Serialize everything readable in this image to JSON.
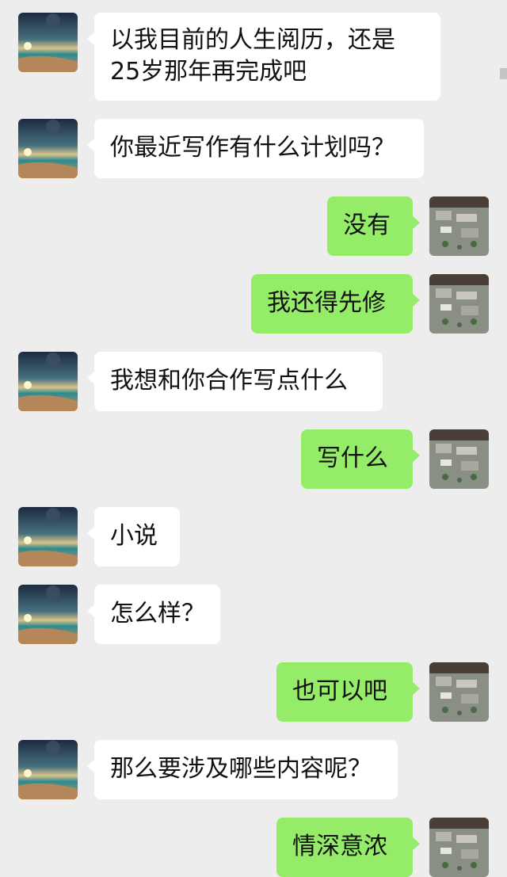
{
  "messages": [
    {
      "side": "in",
      "text": "以我目前的人生阅历，还是\n25岁那年再完成吧"
    },
    {
      "side": "in",
      "text": "你最近写作有什么计划吗？"
    },
    {
      "side": "out",
      "text": "没有"
    },
    {
      "side": "out",
      "text": "我还得先修"
    },
    {
      "side": "in",
      "text": "我想和你合作写点什么"
    },
    {
      "side": "out",
      "text": "写什么"
    },
    {
      "side": "in",
      "text": "小说"
    },
    {
      "side": "in",
      "text": "怎么样？"
    },
    {
      "side": "out",
      "text": "也可以吧"
    },
    {
      "side": "in",
      "text": "那么要涉及哪些内容呢？"
    },
    {
      "side": "out",
      "text": "情深意浓"
    }
  ],
  "colors": {
    "background": "#ededed",
    "incoming_bubble": "#ffffff",
    "outgoing_bubble": "#95ec69"
  },
  "icons": {
    "contact_avatar": "seascape-sunset-avatar",
    "self_avatar": "aerial-town-avatar"
  }
}
